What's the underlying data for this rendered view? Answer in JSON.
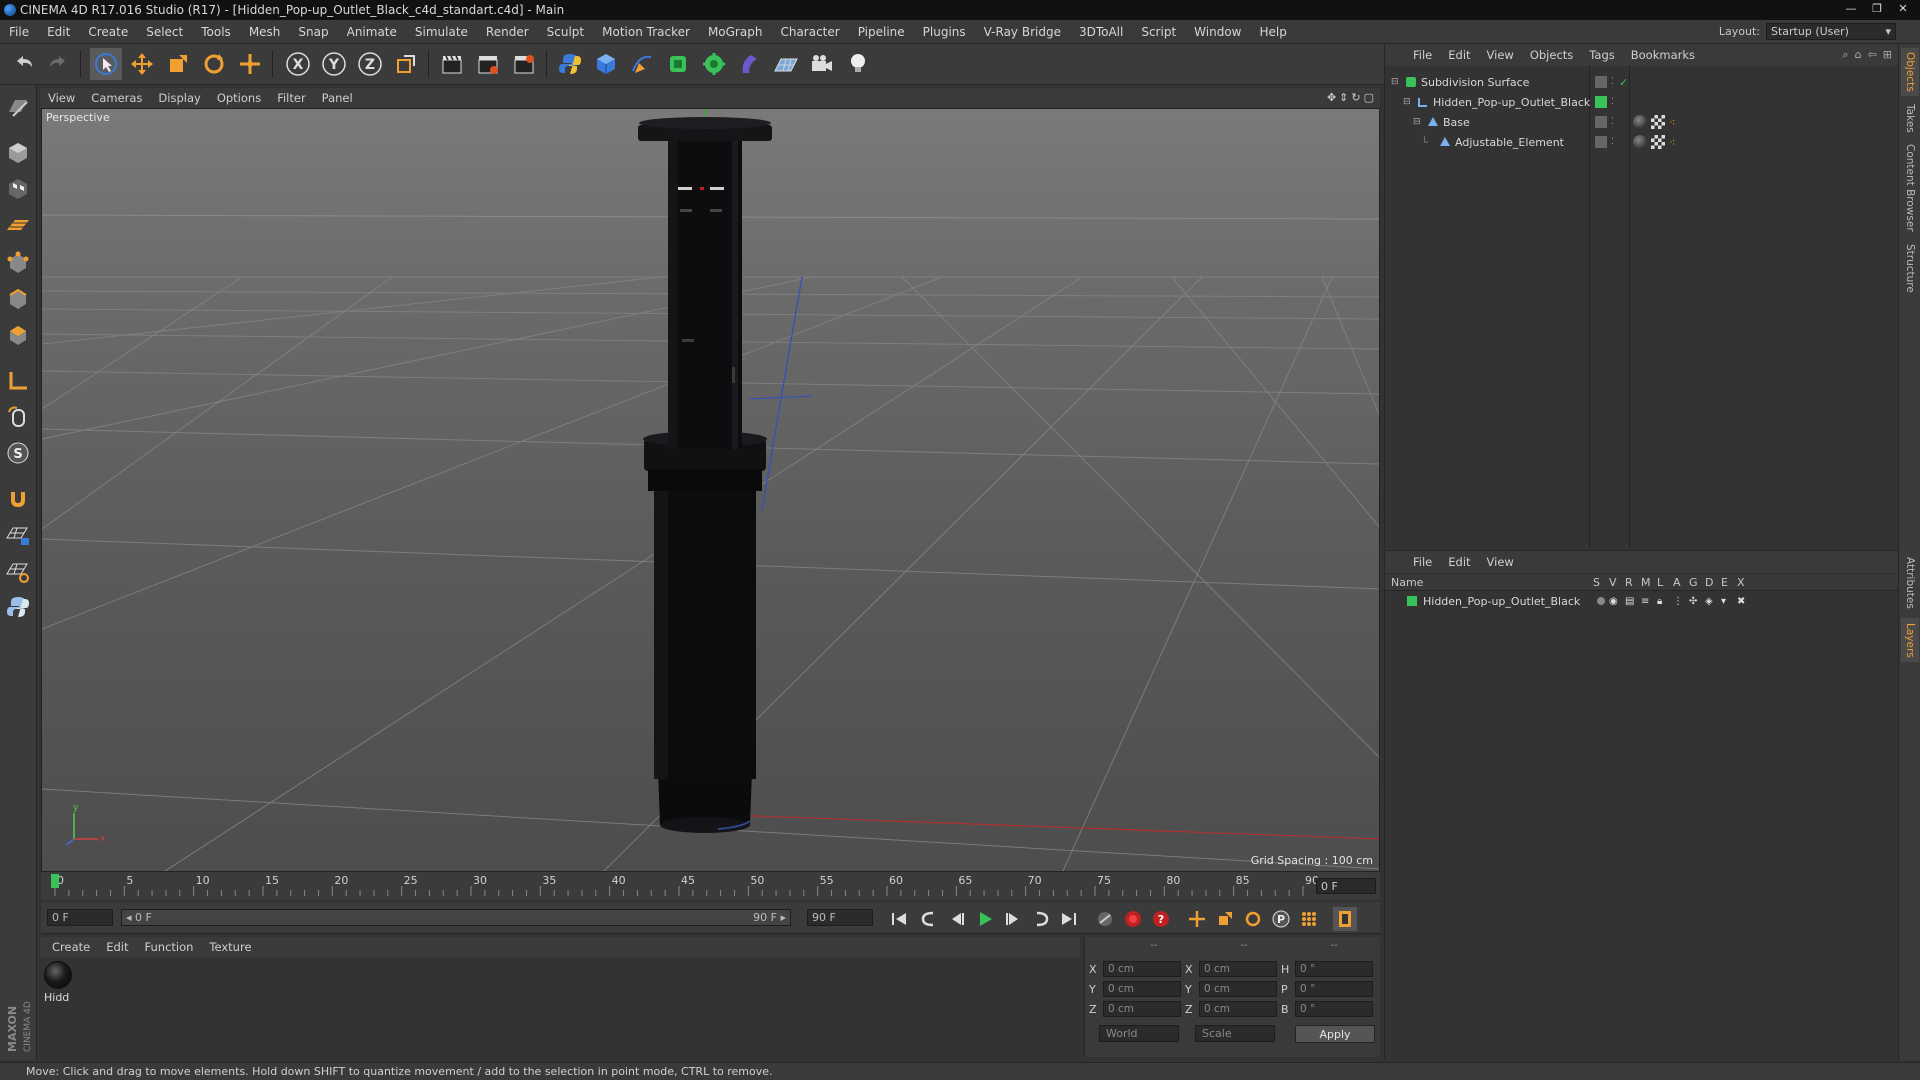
{
  "window": {
    "title": "CINEMA 4D R17.016 Studio (R17) - [Hidden_Pop-up_Outlet_Black_c4d_standart.c4d] - Main",
    "controls": [
      "—",
      "❐",
      "✕"
    ]
  },
  "menubar": {
    "items": [
      "File",
      "Edit",
      "Create",
      "Select",
      "Tools",
      "Mesh",
      "Snap",
      "Animate",
      "Simulate",
      "Render",
      "Sculpt",
      "Motion Tracker",
      "MoGraph",
      "Character",
      "Pipeline",
      "Plugins",
      "V-Ray Bridge",
      "3DToAll",
      "Script",
      "Window",
      "Help"
    ],
    "layout_label": "Layout:",
    "layout_value": "Startup (User)"
  },
  "viewport": {
    "menu": [
      "View",
      "Cameras",
      "Display",
      "Options",
      "Filter",
      "Panel"
    ],
    "label": "Perspective",
    "grid_spacing": "Grid Spacing : 100 cm",
    "axis_y": "y",
    "axis_x": "x"
  },
  "timeline": {
    "ticks": [
      "0",
      "5",
      "10",
      "15",
      "20",
      "25",
      "30",
      "35",
      "40",
      "45",
      "50",
      "55",
      "60",
      "65",
      "70",
      "75",
      "80",
      "85",
      "90"
    ],
    "current_frame": "0 F"
  },
  "transport": {
    "start_field": "0 F",
    "range_start": "◂ 0 F",
    "range_end": "90 F ▸",
    "end_field": "90 F"
  },
  "materials": {
    "menu": [
      "Create",
      "Edit",
      "Function",
      "Texture"
    ],
    "items": [
      {
        "name": "Hidd"
      }
    ]
  },
  "coordinates": {
    "header": [
      "--",
      "--",
      "--"
    ],
    "rows": [
      {
        "l1": "X",
        "v1": "0 cm",
        "l2": "X",
        "v2": "0 cm",
        "l3": "H",
        "v3": "0 °"
      },
      {
        "l1": "Y",
        "v1": "0 cm",
        "l2": "Y",
        "v2": "0 cm",
        "l3": "P",
        "v3": "0 °"
      },
      {
        "l1": "Z",
        "v1": "0 cm",
        "l2": "Z",
        "v2": "0 cm",
        "l3": "B",
        "v3": "0 °"
      }
    ],
    "space": "World",
    "mode": "Scale",
    "apply": "Apply"
  },
  "objects_panel": {
    "menu": [
      "File",
      "Edit",
      "View",
      "Objects",
      "Tags",
      "Bookmarks"
    ],
    "tree": [
      {
        "name": "Subdivision Surface",
        "indent": 0
      },
      {
        "name": "Hidden_Pop-up_Outlet_Black",
        "indent": 1
      },
      {
        "name": "Base",
        "indent": 2
      },
      {
        "name": "Adjustable_Element",
        "indent": 3
      }
    ]
  },
  "layers_panel": {
    "menu": [
      "File",
      "Edit",
      "View"
    ],
    "columns": [
      "Name",
      "S",
      "V",
      "R",
      "M",
      "L",
      "A",
      "G",
      "D",
      "E",
      "X"
    ],
    "rows": [
      {
        "name": "Hidden_Pop-up_Outlet_Black",
        "color": "#3ac25a"
      }
    ]
  },
  "side_tabs": [
    "Objects",
    "Takes",
    "Content Browser",
    "Structure",
    "Attributes",
    "Layers"
  ],
  "status": {
    "text": "Move: Click and drag to move elements. Hold down SHIFT to quantize movement / add to the selection in point mode, CTRL to remove."
  },
  "colors": {
    "accent_orange": "#f0a030",
    "toolbar_blue": "#3a7ad8",
    "layer_green": "#3ac25a"
  }
}
